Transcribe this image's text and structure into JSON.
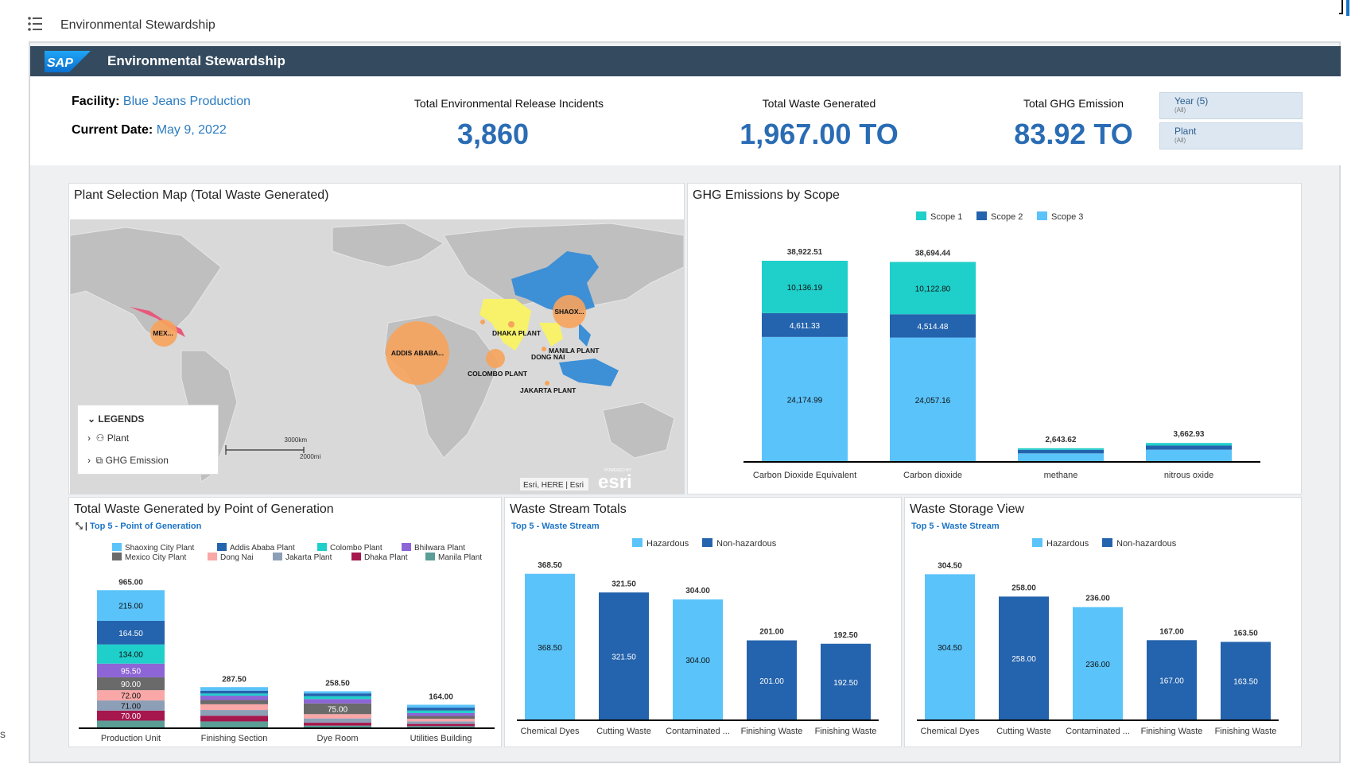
{
  "app": {
    "title": "Environmental Stewardship"
  },
  "shell": {
    "logo": "SAP",
    "title": "Environmental Stewardship"
  },
  "left_edge_text": "s",
  "facility": {
    "label": "Facility:",
    "value": "Blue Jeans Production"
  },
  "current_date": {
    "label": "Current Date:",
    "value": "May 9, 2022"
  },
  "kpis": [
    {
      "label": "Total Environmental Release Incidents",
      "value": "3,860"
    },
    {
      "label": "Total Waste Generated",
      "value": "1,967.00 TO"
    },
    {
      "label": "Total GHG Emission",
      "value": "83.92 TO"
    }
  ],
  "filters": [
    {
      "label": "Year (5)",
      "sub": "(All)"
    },
    {
      "label": "Plant",
      "sub": "(All)"
    }
  ],
  "colors": {
    "scope1": "#1fcfca",
    "scope2": "#2463ad",
    "scope3": "#5ac3fa",
    "hazardous": "#5ac3fa",
    "non_hazardous": "#2463ad",
    "header": "#344a5e",
    "kpi_blue": "#2a6cb4"
  },
  "map": {
    "title": "Plant Selection Map (Total Waste Generated)",
    "labels": [
      {
        "text": "MEX...",
        "big": true
      },
      {
        "text": "ADDIS ABABA...",
        "big": true
      },
      {
        "text": "SHAOX...",
        "big": true
      },
      {
        "text": "DHAKA PLANT"
      },
      {
        "text": "MANILA PLANT"
      },
      {
        "text": "DONG NAI"
      },
      {
        "text": "COLOMBO PLANT"
      },
      {
        "text": "JAKARTA PLANT"
      }
    ],
    "legend": {
      "title": "LEGENDS",
      "items": [
        "Plant",
        "GHG Emission"
      ]
    },
    "scale": {
      "km": "3000km",
      "mi": "2000mi"
    },
    "attribution": "Esri, HERE | Esri",
    "esri_small": "POWERED BY",
    "esri": "esri"
  },
  "ghg": {
    "title": "GHG Emissions by Scope",
    "chart_data": {
      "type": "bar",
      "stacked": true,
      "categories": [
        "Carbon Dioxide Equivalent",
        "Carbon dioxide",
        "methane",
        "nitrous oxide"
      ],
      "series": [
        {
          "name": "Scope 1",
          "values": [
            10136.19,
            10122.8,
            300,
            500
          ]
        },
        {
          "name": "Scope 2",
          "values": [
            4611.33,
            4514.48,
            700,
            800
          ]
        },
        {
          "name": "Scope 3",
          "values": [
            24174.99,
            24057.16,
            1643.62,
            2362.93
          ]
        }
      ],
      "labels": {
        "Scope 1": [
          "10,136.19",
          "10,122.80",
          "",
          ""
        ],
        "Scope 2": [
          "4,611.33",
          "4,514.48",
          "",
          ""
        ],
        "Scope 3": [
          "24,174.99",
          "24,057.16",
          "",
          ""
        ]
      },
      "totals": [
        "38,922.51",
        "38,694.44",
        "2,643.62",
        "3,662.93"
      ],
      "total_values": [
        38922.51,
        38694.44,
        2643.62,
        3662.93
      ],
      "legend_position": "top",
      "ylim": [
        0,
        40000
      ]
    }
  },
  "waste_point": {
    "title": "Total Waste Generated by Point of Generation",
    "subtitle": "Top 5 - Point of Generation",
    "chart_data": {
      "type": "bar",
      "stacked": true,
      "categories": [
        "Production Unit",
        "Finishing Section",
        "Dye Room",
        "Utilities Building"
      ],
      "series": [
        {
          "name": "Shaoxing City Plant",
          "color": "#5ac3fa",
          "values": [
            215.0,
            25,
            15,
            20
          ]
        },
        {
          "name": "Addis Ababa Plant",
          "color": "#2463ad",
          "values": [
            164.5,
            20,
            20,
            20
          ]
        },
        {
          "name": "Colombo Plant",
          "color": "#1fcfca",
          "values": [
            134.0,
            15,
            20,
            18
          ]
        },
        {
          "name": "Bhilwara Plant",
          "color": "#8d65d6",
          "values": [
            95.5,
            30,
            30,
            20
          ]
        },
        {
          "name": "Mexico City Plant",
          "color": "#6a6a6a",
          "values": [
            90.0,
            30,
            75.0,
            20
          ]
        },
        {
          "name": "Dong Nai",
          "color": "#f9a7a7",
          "values": [
            72.0,
            40,
            30,
            18
          ]
        },
        {
          "name": "Jakarta Plant",
          "color": "#8c9fb7",
          "values": [
            71.0,
            40,
            30,
            18
          ]
        },
        {
          "name": "Dhaka Plant",
          "color": "#a6174d",
          "values": [
            70.0,
            40,
            20,
            15
          ]
        },
        {
          "name": "Manila Plant",
          "color": "#5a9e96",
          "values": [
            53.0,
            47.5,
            18.5,
            15
          ]
        }
      ],
      "segment_labels": [
        [
          "215.00",
          "164.50",
          "134.00",
          "95.50",
          "90.00",
          "72.00",
          "71.00",
          "70.00",
          ""
        ],
        [
          "",
          "",
          "",
          "",
          "",
          "",
          "",
          "",
          ""
        ],
        [
          "",
          "",
          "",
          "",
          "75.00",
          "",
          "",
          "",
          ""
        ],
        [
          "",
          "",
          "",
          "",
          "",
          "",
          "",
          "",
          ""
        ]
      ],
      "totals": [
        "965.00",
        "287.50",
        "258.50",
        "164.00"
      ],
      "total_values": [
        965.0,
        287.5,
        258.5,
        164.0
      ],
      "legend_position": "top",
      "ylim": [
        0,
        1000
      ]
    }
  },
  "waste_stream": {
    "title": "Waste Stream Totals",
    "subtitle": "Top 5 - Waste Stream",
    "chart_data": {
      "type": "bar",
      "categories": [
        "Chemical Dyes",
        "Cutting Waste",
        "Contaminated ...",
        "Finishing Waste",
        "Finishing Waste"
      ],
      "series": [
        {
          "name": "Hazardous"
        },
        {
          "name": "Non-hazardous"
        }
      ],
      "values": [
        368.5,
        321.5,
        304.0,
        201.0,
        192.5
      ],
      "value_labels": [
        "368.50",
        "321.50",
        "304.00",
        "201.00",
        "192.50"
      ],
      "bar_series": [
        "Hazardous",
        "Non-hazardous",
        "Hazardous",
        "Non-hazardous",
        "Non-hazardous"
      ],
      "legend_position": "top",
      "ylim": [
        0,
        380
      ]
    }
  },
  "waste_storage": {
    "title": "Waste Storage View",
    "subtitle": "Top 5 - Waste Stream",
    "chart_data": {
      "type": "bar",
      "categories": [
        "Chemical Dyes",
        "Cutting Waste",
        "Contaminated ...",
        "Finishing Waste",
        "Finishing Waste"
      ],
      "series": [
        {
          "name": "Hazardous"
        },
        {
          "name": "Non-hazardous"
        }
      ],
      "values": [
        304.5,
        258.0,
        236.0,
        167.0,
        163.5
      ],
      "value_labels": [
        "304.50",
        "258.00",
        "236.00",
        "167.00",
        "163.50"
      ],
      "bar_series": [
        "Hazardous",
        "Non-hazardous",
        "Hazardous",
        "Non-hazardous",
        "Non-hazardous"
      ],
      "legend_position": "top",
      "ylim": [
        0,
        315
      ]
    }
  }
}
